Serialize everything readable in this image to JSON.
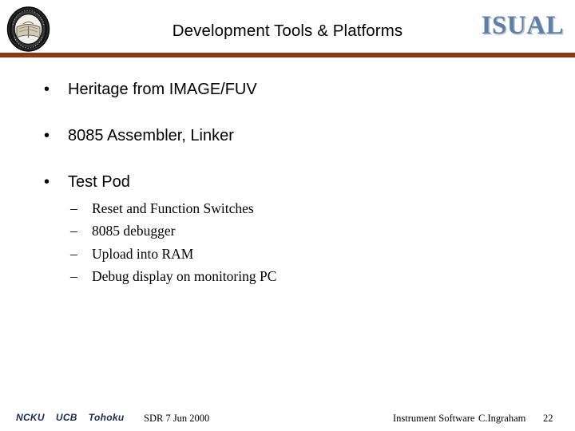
{
  "header": {
    "title": "Development Tools & Platforms",
    "seal_icon": "university-seal-icon",
    "logo_text": "ISUAL",
    "rule_color": "#8a3a12",
    "logo_color": "#5d7fa8"
  },
  "body": {
    "bullet_marker": "•",
    "sub_bullet_marker": "–",
    "bullets": [
      {
        "text": "Heritage from IMAGE/FUV"
      },
      {
        "text": "8085 Assembler, Linker"
      },
      {
        "text": "Test Pod"
      }
    ],
    "sub_bullets": [
      {
        "text": "Reset and Function Switches"
      },
      {
        "text": "8085 debugger"
      },
      {
        "text": "Upload into RAM"
      },
      {
        "text": "Debug display on monitoring PC"
      }
    ]
  },
  "footer": {
    "institutions": [
      "NCKU",
      "UCB",
      "Tohoku"
    ],
    "institutions_color": "#1b2a5e",
    "review": "SDR 7 Jun 2000",
    "subsystem": "Instrument Software",
    "author": "C.Ingraham",
    "page_number": "22"
  }
}
